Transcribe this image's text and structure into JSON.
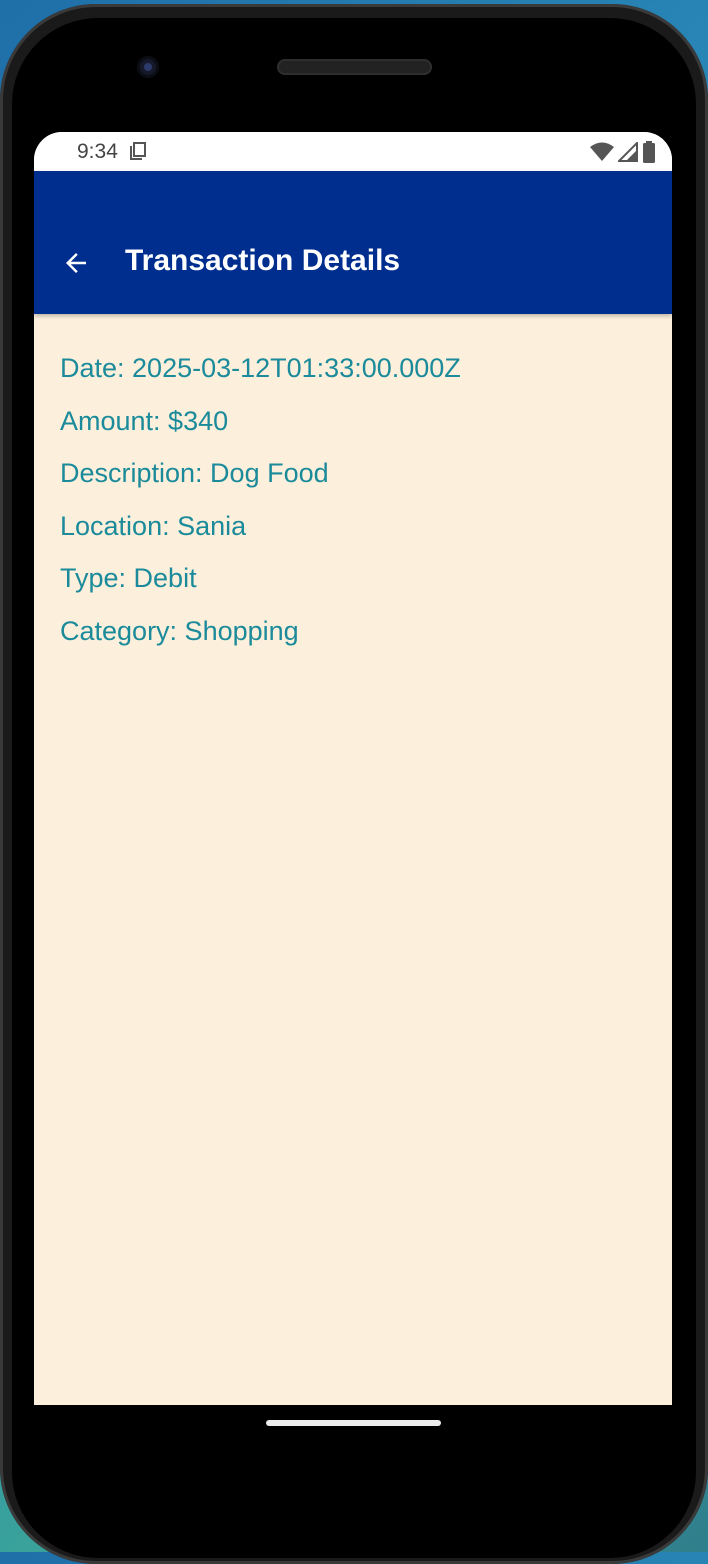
{
  "status_bar": {
    "time": "9:34",
    "icons": [
      "sim-card-icon",
      "wifi-icon",
      "signal-icon",
      "battery-icon"
    ]
  },
  "app_bar": {
    "back_icon": "arrow-left-icon",
    "title": "Transaction Details",
    "color": "#002e8f"
  },
  "details": {
    "date": "Date: 2025-03-12T01:33:00.000Z",
    "amount": "Amount: $340",
    "description": "Description: Dog Food",
    "location": "Location: Sania",
    "type": "Type: Debit",
    "category": "Category: Shopping"
  },
  "colors": {
    "background": "#fcf0dc",
    "detail_text": "#1b8a9a"
  }
}
